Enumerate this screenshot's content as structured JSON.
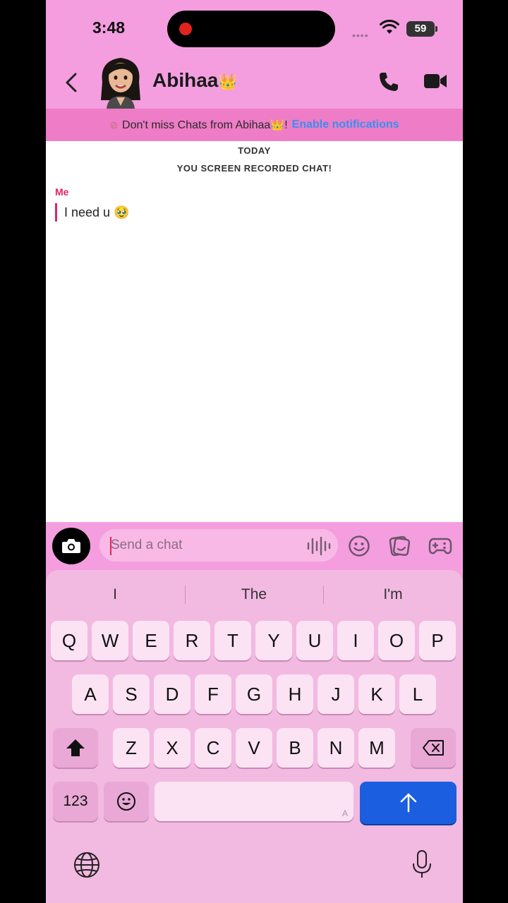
{
  "status": {
    "time": "3:48",
    "battery": "59"
  },
  "header": {
    "contact_name": "Abihaa",
    "crown": "👑"
  },
  "banner": {
    "text": "Don't miss Chats from Abihaa👑!",
    "link": "Enable notifications"
  },
  "chat": {
    "date_label": "TODAY",
    "event_label": "YOU SCREEN RECORDED CHAT!",
    "messages": [
      {
        "sender": "Me",
        "text": "I need u 🥹"
      }
    ]
  },
  "input": {
    "placeholder": "Send a chat"
  },
  "keyboard": {
    "suggestions": [
      "I",
      "The",
      "I'm"
    ],
    "row1": [
      "Q",
      "W",
      "E",
      "R",
      "T",
      "Y",
      "U",
      "I",
      "O",
      "P"
    ],
    "row2": [
      "A",
      "S",
      "D",
      "F",
      "G",
      "H",
      "J",
      "K",
      "L"
    ],
    "row3": [
      "Z",
      "X",
      "C",
      "V",
      "B",
      "N",
      "M"
    ],
    "numbers_key": "123",
    "space_hint": "A"
  },
  "colors": {
    "accent": "#f49ee0",
    "banner": "#ee7cc6",
    "link": "#3a8ff0",
    "send": "#1b5fe0",
    "me": "#e0245e"
  }
}
